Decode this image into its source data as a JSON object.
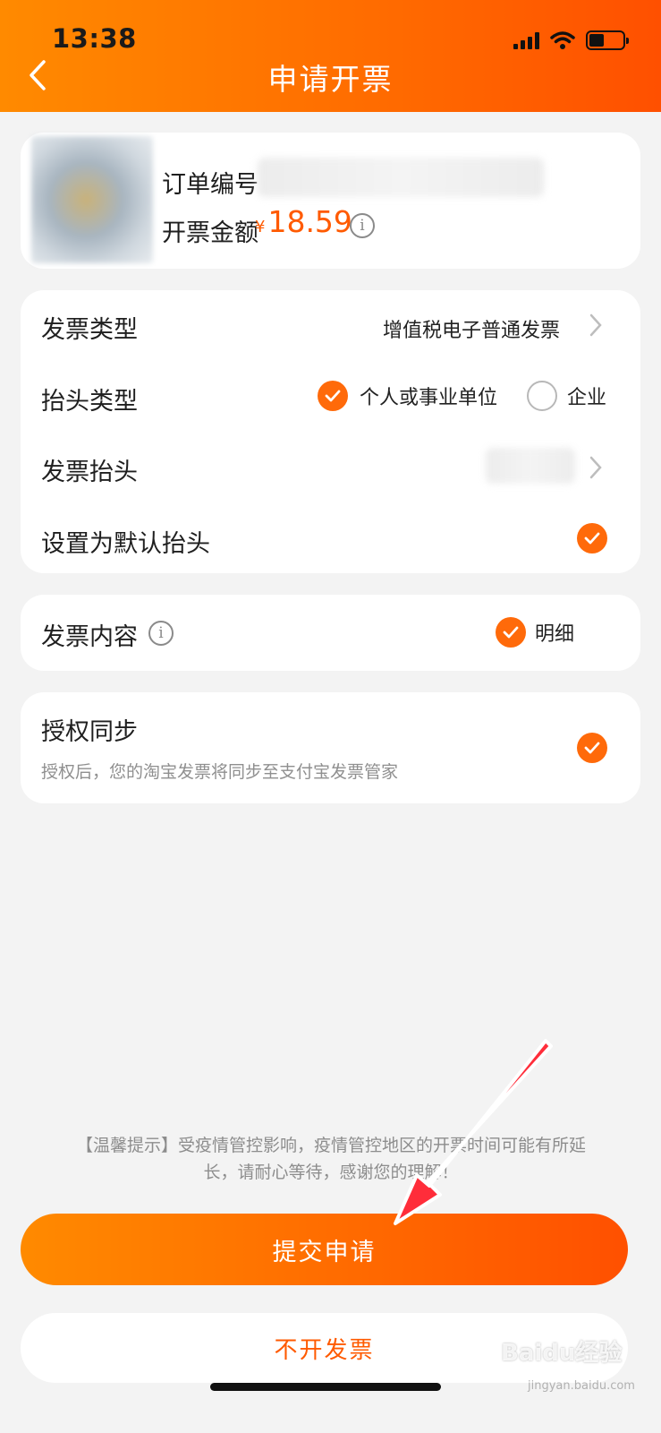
{
  "status_bar": {
    "time": "13:38"
  },
  "header": {
    "title": "申请开票"
  },
  "order": {
    "order_no_label": "订单编号",
    "amount_label": "开票金额",
    "currency": "¥",
    "amount": "18.59"
  },
  "invoice": {
    "type_label": "发票类型",
    "type_value": "增值税电子普通发票",
    "title_type_label": "抬头类型",
    "title_type_options": [
      "个人或事业单位",
      "企业"
    ],
    "title_type_selected": "个人或事业单位",
    "title_label": "发票抬头",
    "default_title_label": "设置为默认抬头",
    "default_title_checked": true
  },
  "content": {
    "label": "发票内容",
    "option": "明细",
    "checked": true
  },
  "auth": {
    "label": "授权同步",
    "desc": "授权后，您的淘宝发票将同步至支付宝发票管家",
    "checked": true
  },
  "tip": {
    "line1": "【温馨提示】受疫情管控影响，疫情管控地区的开票时间可能有所延",
    "line2": "长，请耐心等待，感谢您的理解！"
  },
  "buttons": {
    "submit": "提交申请",
    "cancel": "不开发票"
  },
  "watermark": {
    "text": "Baidu经验",
    "sub": "jingyan.baidu.com"
  },
  "colors": {
    "accent": "#ff6a00",
    "price": "#ff5a00",
    "background": "#f3f3f3"
  }
}
